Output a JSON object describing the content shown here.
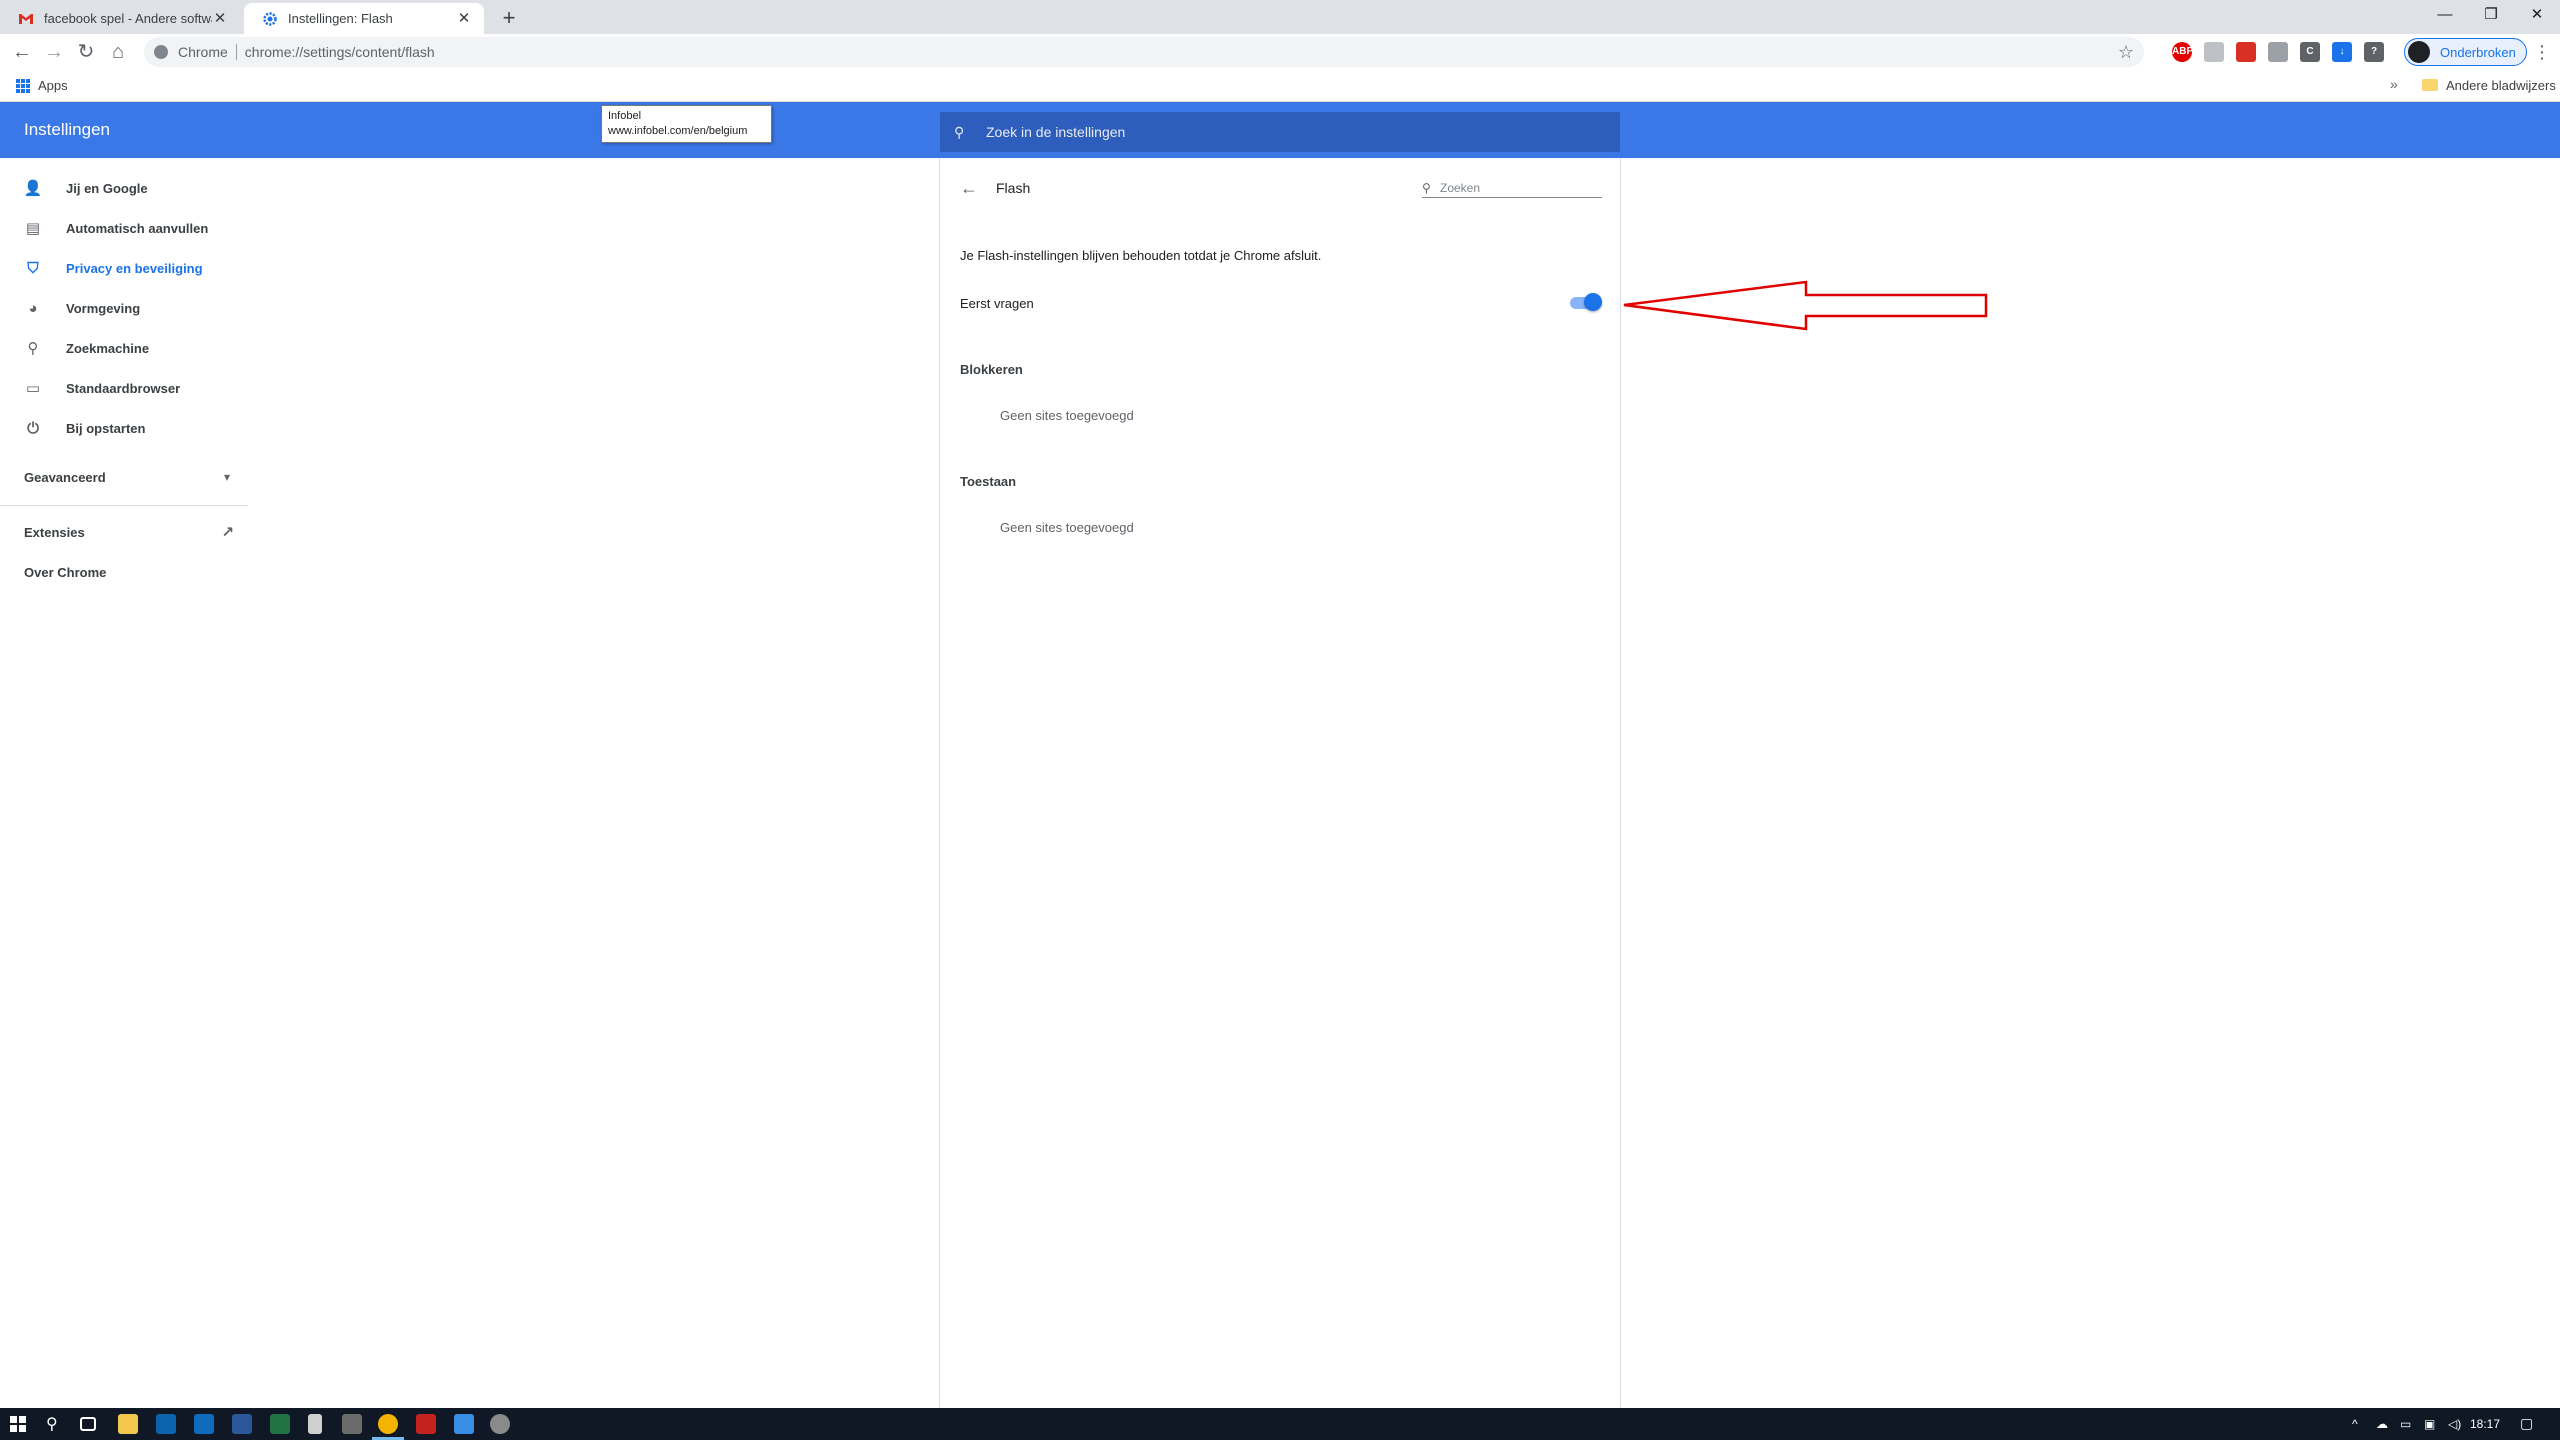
{
  "window": {
    "tabs": [
      {
        "label": "facebook spel - Andere software",
        "icon": "gmail-icon",
        "active": false
      },
      {
        "label": "Instellingen: Flash",
        "icon": "gear-icon",
        "active": true
      }
    ],
    "new_tab": "+",
    "controls": {
      "minimize": "—",
      "restore": "❐",
      "close": "✕"
    }
  },
  "toolbar": {
    "back": "←",
    "forward": "→",
    "reload": "↻",
    "home": "⌂",
    "origin_chip": "Chrome",
    "url": "chrome://settings/content/flash",
    "star": "☆",
    "profile_label": "Onderbroken",
    "menu": "⋮",
    "extensions": [
      {
        "name": "abp-extension-icon",
        "color": "#e40000",
        "glyph": "ABP"
      },
      {
        "name": "extension-2-icon",
        "color": "#bdc1c6",
        "glyph": ""
      },
      {
        "name": "extension-3-icon",
        "color": "#d93025",
        "glyph": ""
      },
      {
        "name": "extension-4-icon",
        "color": "#9aa0a6",
        "glyph": ""
      },
      {
        "name": "extension-5-icon",
        "color": "#5f6368",
        "glyph": "C"
      },
      {
        "name": "extension-6-icon",
        "color": "#1a73e8",
        "glyph": "↓"
      },
      {
        "name": "extension-7-icon",
        "color": "#5f6368",
        "glyph": "?"
      }
    ]
  },
  "bookmarks": {
    "apps": "Apps",
    "overflow": "»",
    "other": "Andere bladwijzers"
  },
  "tooltip": {
    "title": "Infobel",
    "url": "www.infobel.com/en/belgium"
  },
  "header": {
    "title": "Instellingen",
    "search_placeholder": "Zoek in de instellingen"
  },
  "sidebar": {
    "items": [
      {
        "label": "Jij en Google",
        "icon": "person-icon",
        "glyph": "👤"
      },
      {
        "label": "Automatisch aanvullen",
        "icon": "clipboard-icon",
        "glyph": "▤"
      },
      {
        "label": "Privacy en beveiliging",
        "icon": "shield-icon",
        "glyph": "⛉"
      },
      {
        "label": "Vormgeving",
        "icon": "palette-icon",
        "glyph": "◕"
      },
      {
        "label": "Zoekmachine",
        "icon": "search-icon",
        "glyph": "⚲"
      },
      {
        "label": "Standaardbrowser",
        "icon": "browser-icon",
        "glyph": "▭"
      },
      {
        "label": "Bij opstarten",
        "icon": "power-icon",
        "glyph": "⏻"
      }
    ],
    "advanced": "Geavanceerd",
    "advanced_chevron": "▾",
    "extensions": "Extensies",
    "extensions_link_icon": "↗",
    "about": "Over Chrome"
  },
  "flash": {
    "back": "←",
    "title": "Flash",
    "search_icon": "⚲",
    "search_placeholder": "Zoeken",
    "info": "Je Flash-instellingen blijven behouden totdat je Chrome afsluit.",
    "ask_first_label": "Eerst vragen",
    "ask_first_enabled": true,
    "block": {
      "title": "Blokkeren",
      "empty": "Geen sites toegevoegd"
    },
    "allow": {
      "title": "Toestaan",
      "empty": "Geen sites toegevoegd"
    }
  },
  "taskbar": {
    "clock": "18:17",
    "tray_chevron": "^"
  },
  "colors": {
    "accent": "#1a73e8",
    "header_blue": "#3b78e7",
    "annotation_red": "#e00000",
    "taskbar": "#101826"
  }
}
